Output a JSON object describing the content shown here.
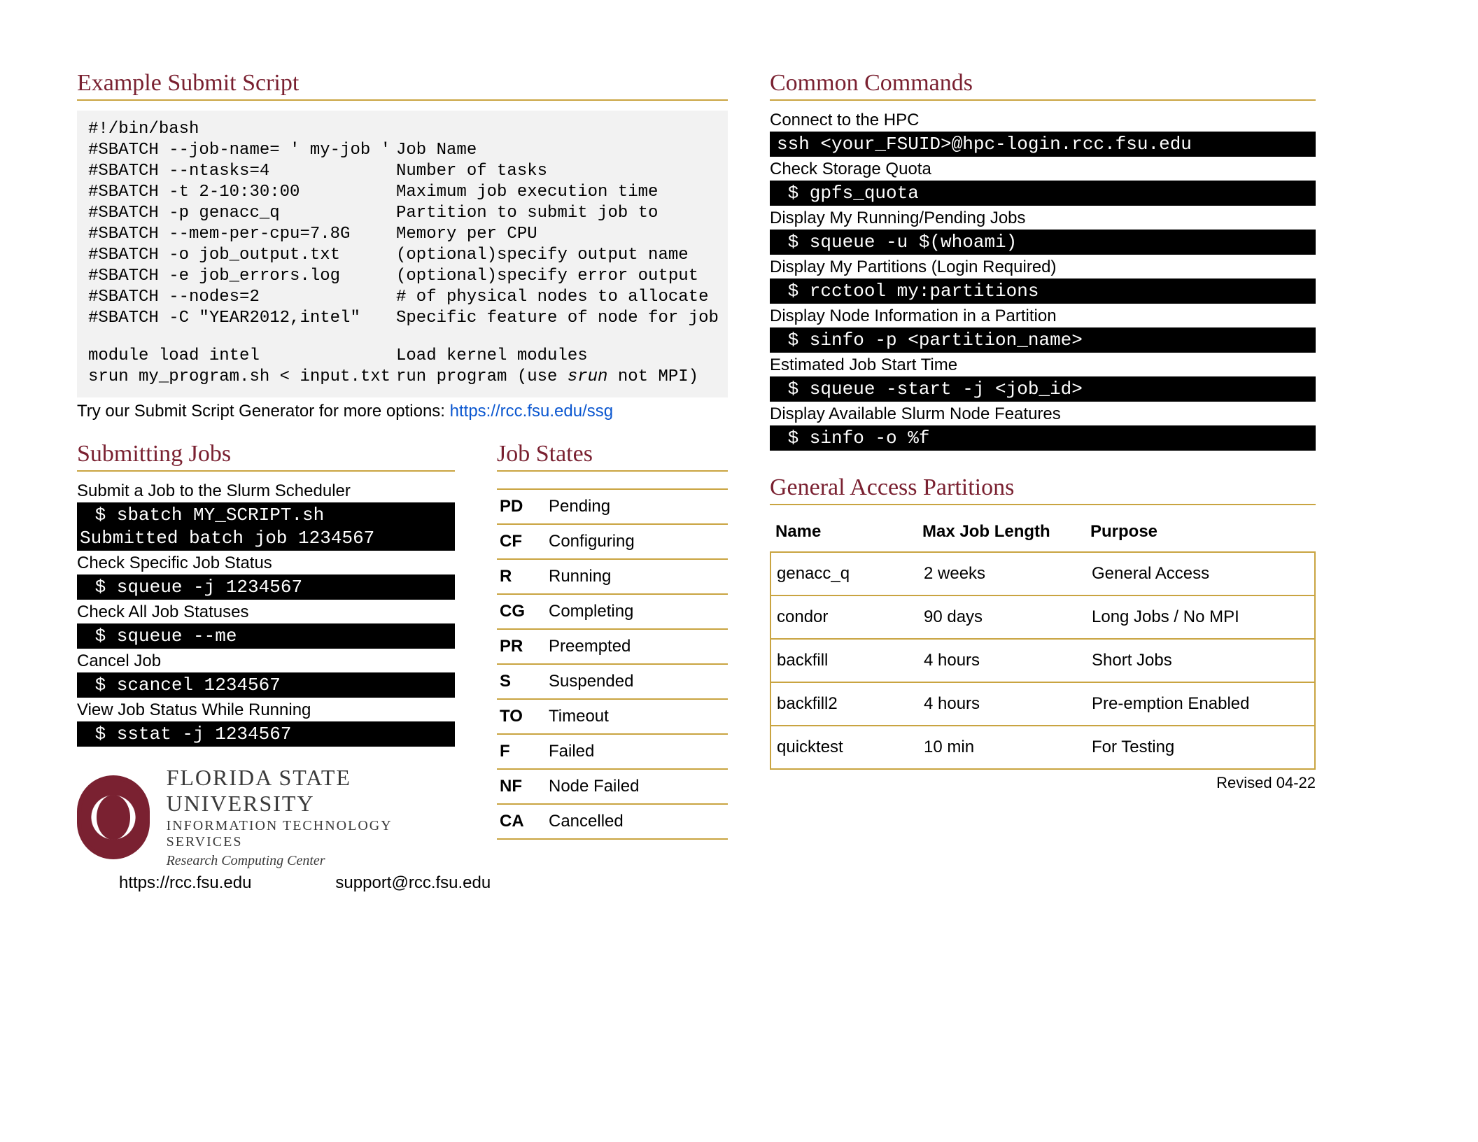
{
  "scriptSection": {
    "title": "Example Submit Script",
    "rows": [
      {
        "l": "#!/bin/bash",
        "r": ""
      },
      {
        "l": "#SBATCH --job-name= ' my-job '",
        "r": "Job Name"
      },
      {
        "l": "#SBATCH --ntasks=4",
        "r": "Number of tasks"
      },
      {
        "l": "#SBATCH -t 2-10:30:00",
        "r": "Maximum job execution time"
      },
      {
        "l": "#SBATCH -p genacc_q",
        "r": "Partition to submit job to"
      },
      {
        "l": "#SBATCH --mem-per-cpu=7.8G",
        "r": "Memory per CPU"
      },
      {
        "l": "#SBATCH -o job_output.txt",
        "r": "(optional)specify output name"
      },
      {
        "l": "#SBATCH -e job_errors.log",
        "r": "(optional)specify error output"
      },
      {
        "l": "#SBATCH --nodes=2",
        "r": "# of physical nodes to allocate"
      },
      {
        "l": "#SBATCH -C \"YEAR2012,intel\"",
        "r": "Specific feature of node for job"
      }
    ],
    "rows2": [
      {
        "l": "module load intel",
        "r": "Load kernel modules"
      },
      {
        "l": "srun my_program.sh < input.txt",
        "r_pre": "run program (use ",
        "r_em": "srun",
        "r_post": " not MPI)"
      }
    ],
    "ssg_text": "Try our Submit Script Generator for more options: ",
    "ssg_url": "https://rcc.fsu.edu/ssg"
  },
  "submitting": {
    "title": "Submitting Jobs",
    "items": [
      {
        "label": "Submit a Job to the Slurm Scheduler",
        "cmd": " $ sbatch MY_SCRIPT.sh",
        "out": "Submitted batch job 1234567"
      },
      {
        "label": "Check Specific Job Status",
        "cmd": " $ squeue -j 1234567"
      },
      {
        "label": "Check All Job Statuses",
        "cmd": " $ squeue --me"
      },
      {
        "label": "Cancel Job",
        "cmd": " $ scancel 1234567"
      },
      {
        "label": "View Job Status While Running",
        "cmd": " $ sstat -j 1234567"
      }
    ]
  },
  "jobStates": {
    "title": "Job States",
    "rows": [
      {
        "code": "PD",
        "desc": "Pending"
      },
      {
        "code": "CF",
        "desc": "Configuring"
      },
      {
        "code": "R",
        "desc": "Running"
      },
      {
        "code": "CG",
        "desc": "Completing"
      },
      {
        "code": "PR",
        "desc": "Preempted"
      },
      {
        "code": "S",
        "desc": "Suspended"
      },
      {
        "code": "TO",
        "desc": "Timeout"
      },
      {
        "code": "F",
        "desc": "Failed"
      },
      {
        "code": "NF",
        "desc": "Node Failed"
      },
      {
        "code": "CA",
        "desc": "Cancelled"
      }
    ]
  },
  "common": {
    "title": "Common Commands",
    "items": [
      {
        "label": "Connect to the HPC",
        "cmd": "ssh <your_FSUID>@hpc-login.rcc.fsu.edu"
      },
      {
        "label": "Check Storage Quota",
        "cmd": " $ gpfs_quota"
      },
      {
        "label": "Display My Running/Pending Jobs",
        "cmd": " $ squeue -u $(whoami)"
      },
      {
        "label": "Display My Partitions (Login Required)",
        "cmd": " $ rcctool my:partitions"
      },
      {
        "label": "Display Node Information in a Partition",
        "cmd": " $ sinfo -p <partition_name>"
      },
      {
        "label": "Estimated Job Start Time",
        "cmd": " $ squeue -start -j <job_id>"
      },
      {
        "label": "Display Available Slurm Node Features",
        "cmd": " $ sinfo -o %f"
      }
    ]
  },
  "partitions": {
    "title": "General Access Partitions",
    "head": {
      "c1": "Name",
      "c2": "Max Job Length",
      "c3": "Purpose"
    },
    "rows": [
      {
        "c1": "genacc_q",
        "c2": "2 weeks",
        "c3": "General Access"
      },
      {
        "c1": "condor",
        "c2": "90 days",
        "c3": "Long Jobs / No MPI"
      },
      {
        "c1": "backfill",
        "c2": "4 hours",
        "c3": "Short Jobs"
      },
      {
        "c1": "backfill2",
        "c2": "4 hours",
        "c3": "Pre-emption Enabled"
      },
      {
        "c1": "quicktest",
        "c2": "10 min",
        "c3": "For Testing"
      }
    ]
  },
  "footer": {
    "line1": "FLORIDA STATE UNIVERSITY",
    "line2": "INFORMATION TECHNOLOGY SERVICES",
    "line3": "Research Computing Center",
    "url": "https://rcc.fsu.edu",
    "email": "support@rcc.fsu.edu",
    "revised": "Revised 04-22"
  }
}
